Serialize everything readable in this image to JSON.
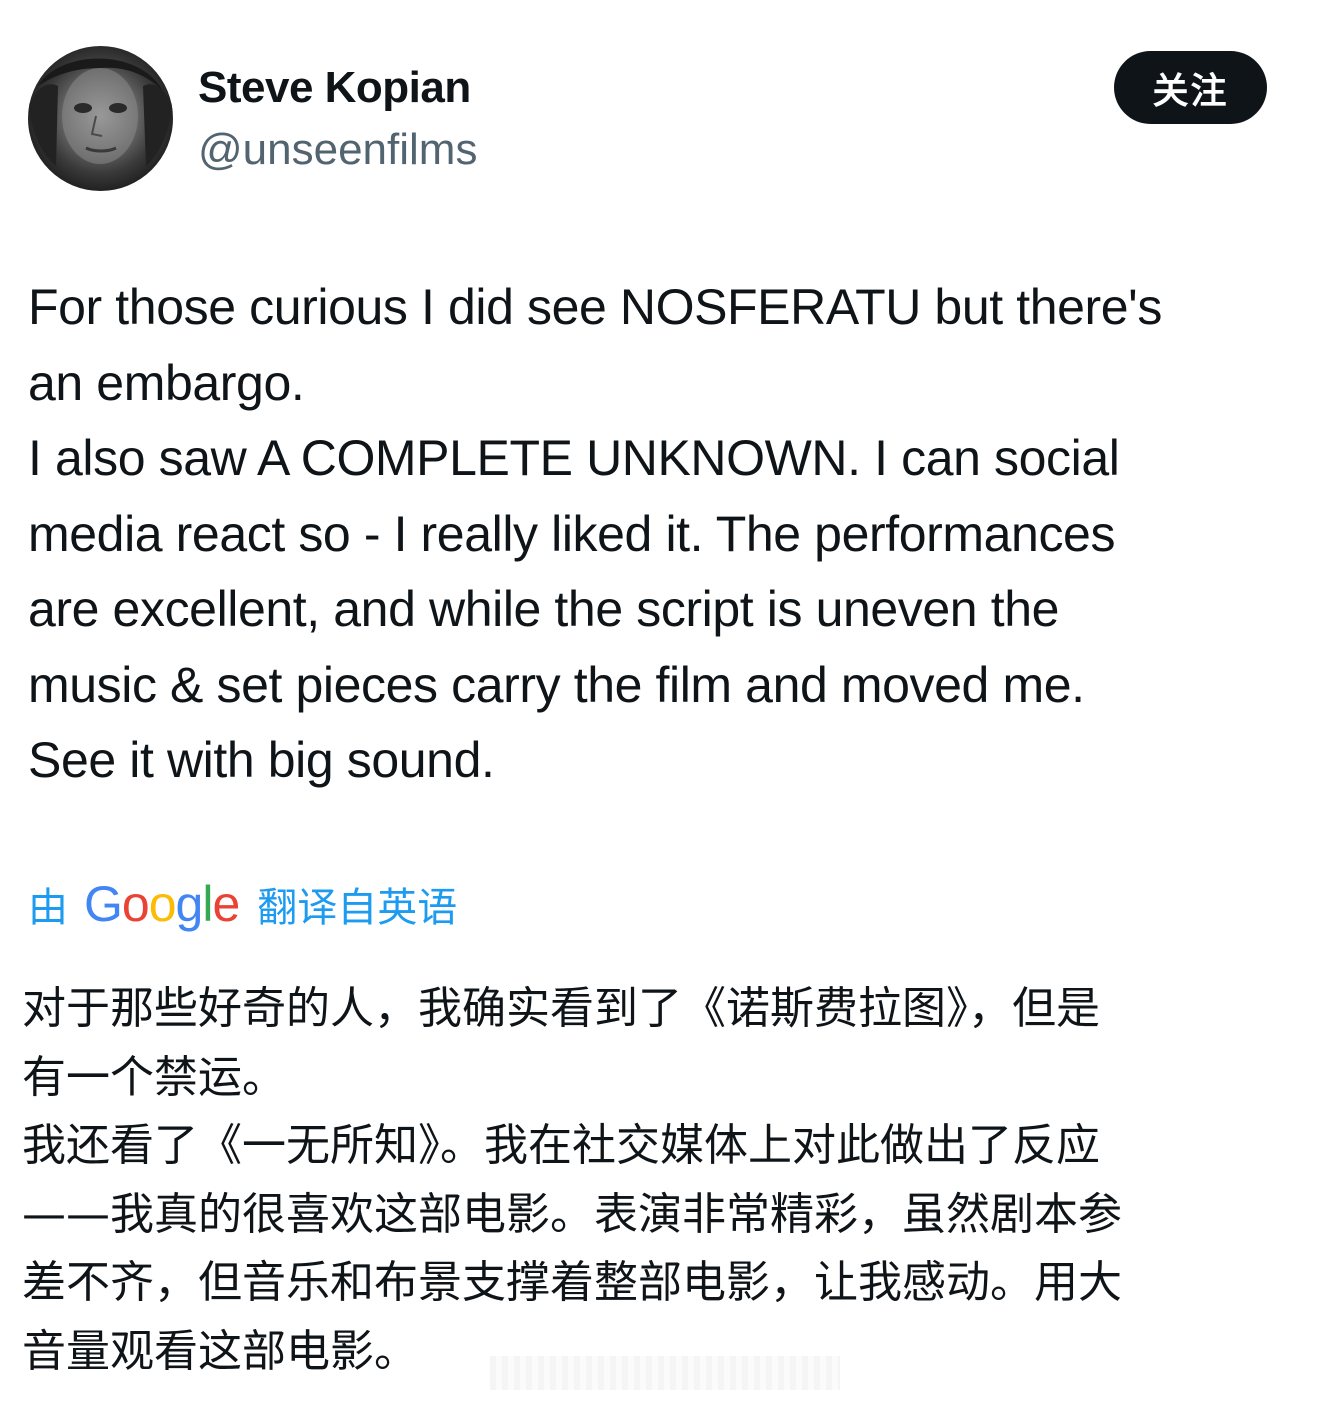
{
  "author": {
    "name": "Steve Kopian",
    "handle": "@unseenfilms"
  },
  "follow_button": {
    "label": "关注"
  },
  "tweet": {
    "text": "For those curious I did see NOSFERATU but there's\nan embargo.\nI also saw A COMPLETE UNKNOWN. I can social\nmedia react so - I really liked it. The performances\nare excellent, and while the script is uneven the\nmusic & set pieces carry the film and moved me.\nSee it with big sound."
  },
  "translation": {
    "prefix": "由",
    "google_logo": [
      "G",
      "o",
      "o",
      "g",
      "l",
      "e"
    ],
    "suffix": "翻译自英语",
    "colors": {
      "link": "#1d9bf0",
      "google_blue": "#4285f4",
      "google_red": "#ea4335",
      "google_yellow": "#fbbc05",
      "google_green": "#34a853"
    },
    "text": "对于那些好奇的人，我确实看到了《诺斯费拉图》，但是\n有一个禁运。\n我还看了《一无所知》。我在社交媒体上对此做出了反应\n——我真的很喜欢这部电影。表演非常精彩，虽然剧本参\n差不齐，但音乐和布景支撑着整部电影，让我感动。用大\n音量观看这部电影。"
  },
  "colors": {
    "text_primary": "#0f1419",
    "text_secondary": "#536471",
    "button_bg": "#0f1419",
    "button_text": "#ffffff"
  }
}
